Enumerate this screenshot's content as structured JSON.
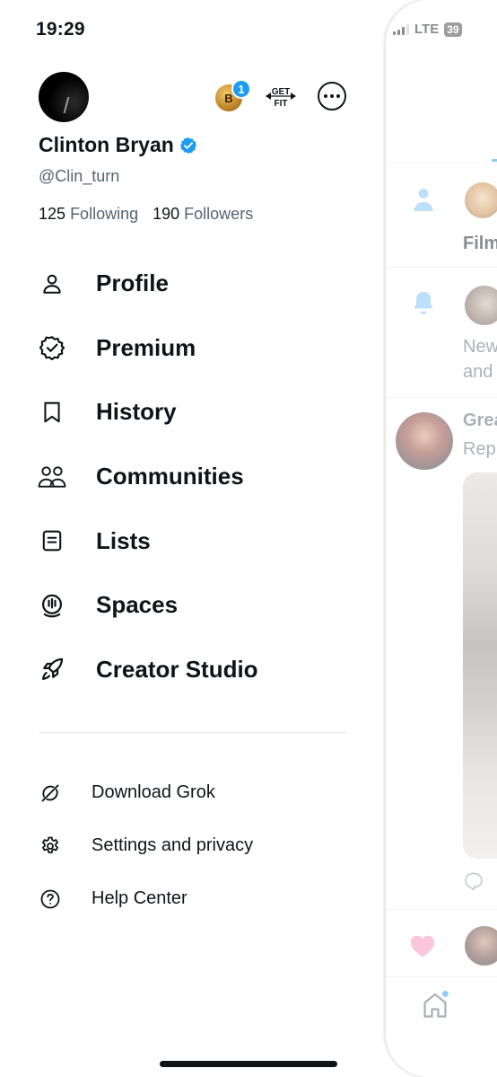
{
  "status_bar": {
    "time": "19:29",
    "network": "LTE",
    "battery": "39"
  },
  "header": {
    "coin_label": "B",
    "badge_count": "1",
    "app_logo_text": "GET FIT"
  },
  "profile": {
    "name": "Clinton Bryan",
    "handle": "@Clin_turn",
    "following_count": "125",
    "following_label": "Following",
    "followers_count": "190",
    "followers_label": "Followers"
  },
  "menu": {
    "items": [
      {
        "label": "Profile",
        "icon": "person-icon"
      },
      {
        "label": "Premium",
        "icon": "verified-badge-icon"
      },
      {
        "label": "History",
        "icon": "bookmark-icon"
      },
      {
        "label": "Communities",
        "icon": "communities-icon"
      },
      {
        "label": "Lists",
        "icon": "list-icon"
      },
      {
        "label": "Spaces",
        "icon": "spaces-icon"
      },
      {
        "label": "Creator Studio",
        "icon": "rocket-icon"
      }
    ]
  },
  "submenu": {
    "items": [
      {
        "label": "Download Grok",
        "icon": "grok-icon"
      },
      {
        "label": "Settings and privacy",
        "icon": "gear-icon"
      },
      {
        "label": "Help Center",
        "icon": "help-icon"
      }
    ]
  },
  "panel": {
    "row1_text": "Film",
    "row2_line1": "New",
    "row2_line2": "and",
    "post_author": "Grea",
    "post_sub": "Rep"
  },
  "colors": {
    "accent": "#1d9bf0",
    "text": "#0f1419",
    "muted": "#536471",
    "like": "#f78bb9"
  }
}
